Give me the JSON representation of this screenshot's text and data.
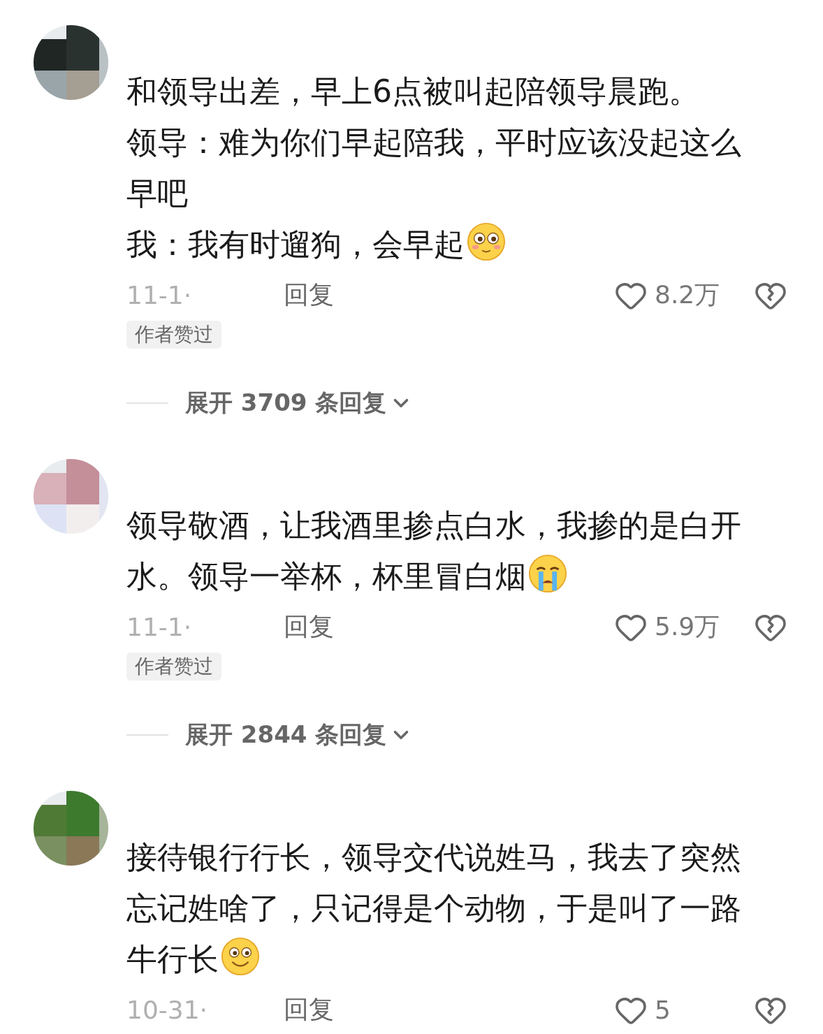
{
  "comments": [
    {
      "lines": [
        [
          {
            "kind": "text",
            "text": "和领导出差，早上6点被叫起陪领导晨跑。"
          }
        ],
        [
          {
            "kind": "text",
            "text": "领导：难为你们早起陪我，平时应该没起这么"
          }
        ],
        [
          {
            "kind": "text",
            "text": "早吧"
          }
        ],
        [
          {
            "kind": "text",
            "text": "我：我有时遛狗，会早起"
          },
          {
            "kind": "blush"
          }
        ]
      ],
      "date": "11-1·",
      "reply": "回复",
      "likes": "8.2万",
      "badge": "作者赞过",
      "expand": "展开 3709 条回复"
    },
    {
      "lines": [
        [
          {
            "kind": "text",
            "text": "领导敬酒，让我酒里掺点白水，我掺的是白开"
          }
        ],
        [
          {
            "kind": "text",
            "text": "水。领导一举杯，杯里冒白烟"
          },
          {
            "kind": "cry"
          }
        ]
      ],
      "date": "11-1·",
      "reply": "回复",
      "likes": "5.9万",
      "badge": "作者赞过",
      "expand": "展开 2844 条回复"
    },
    {
      "lines": [
        [
          {
            "kind": "text",
            "text": "接待银行行长，领导交代说姓马，我去了突然"
          }
        ],
        [
          {
            "kind": "text",
            "text": "忘记姓啥了，只记得是个动物，于是叫了一路"
          }
        ],
        [
          {
            "kind": "text",
            "text": "牛行长"
          },
          {
            "kind": "smile"
          }
        ]
      ],
      "date": "10-31·",
      "reply": "回复",
      "likes": "5"
    }
  ]
}
